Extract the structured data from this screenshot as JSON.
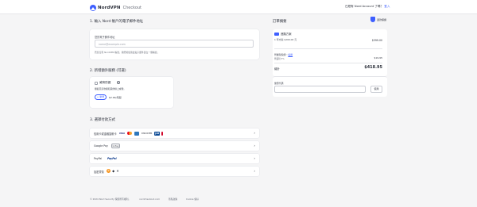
{
  "header": {
    "logo_text": "NordVPN",
    "logo_sub": "Checkout",
    "signin_prefix": "已經有 Nord Account 了嗎？",
    "signin_link": "登入"
  },
  "email_section": {
    "title": "1. 輸入 Nord 帳戶的電子郵件地址",
    "label": "您的電子郵件地址",
    "placeholder": "name@example.com",
    "note": "若您沒有 NordVPN 帳號，我們將使用此電子郵件建立一個帳號。"
  },
  "addon_section": {
    "title": "2. 新增額外服務 (可選)",
    "name": "威脅防護",
    "description": "攔截惡意軟體和其他線上威脅。",
    "button": "+ 新增",
    "price": "$2.99/月起"
  },
  "payment_section": {
    "title": "3. 選擇付款方式",
    "methods": [
      {
        "label": "信用卡或金融簽帳卡"
      },
      {
        "label": "Google Pay",
        "badge": "G Pay"
      },
      {
        "label": "PayPal",
        "badge": "PayPal"
      },
      {
        "label": "加密貨幣"
      }
    ],
    "card_brands": [
      "VISA",
      "Mastercard",
      "AMEX",
      "DISCOVER",
      "JCB",
      "UnionPay"
    ]
  },
  "summary": {
    "title": "訂單摘要",
    "guarantee": "退款保證",
    "plan_name": "進階方案",
    "plan_term": "1 年方案 $299.00 元",
    "plan_price": "$399.00",
    "tax_label": "營業稅稅額・",
    "tax_link": "編輯",
    "tax_rate": "營業稅 5%",
    "tax_amount": "$19.95",
    "total_label": "總計",
    "total_value": "$418.95",
    "coupon_label": "優惠代碼",
    "coupon_button": "使用"
  },
  "footer": {
    "items": [
      "© 2024 Nord Security 保留所有權利。",
      "nordcheckout.com",
      "隱私政策",
      "Cookie 偏好"
    ]
  },
  "colors": {
    "accent": "#3e5fff",
    "background": "#f5f5f6"
  }
}
